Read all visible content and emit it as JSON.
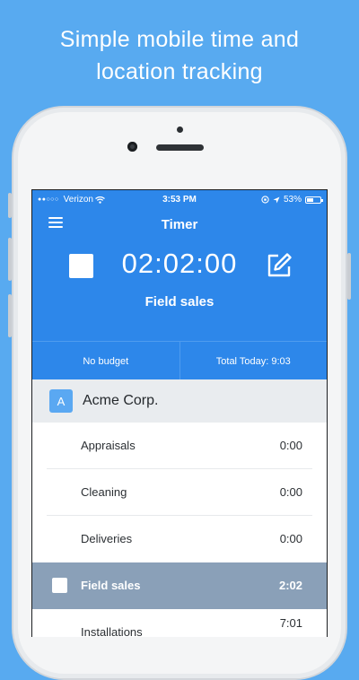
{
  "headline": {
    "line1": "Simple mobile time and",
    "line2": "location tracking"
  },
  "status_bar": {
    "signal": "●●○○○",
    "carrier": "Verizon",
    "time": "3:53 PM",
    "battery": "53%",
    "battery_fraction": 0.53
  },
  "header": {
    "title": "Timer",
    "menu_icon": "hamburger-menu-icon"
  },
  "timer": {
    "elapsed": "02:02:00",
    "activity": "Field sales",
    "stop_icon": "stop-icon",
    "edit_icon": "edit-icon"
  },
  "stats": {
    "budget": "No budget",
    "total_today": "Total Today: 9:03"
  },
  "client": {
    "initial": "A",
    "name": "Acme Corp."
  },
  "tasks": [
    {
      "label": "Appraisals",
      "time": "0:00"
    },
    {
      "label": "Cleaning",
      "time": "0:00"
    },
    {
      "label": "Deliveries",
      "time": "0:00"
    },
    {
      "label": "Field sales",
      "time": "2:02"
    },
    {
      "label": "Installations",
      "time": "7:01"
    }
  ],
  "colors": {
    "background": "#58aaf0",
    "app_blue": "#2d87ea",
    "active_row": "#8aa0b8",
    "client_bg": "#e9ecef"
  }
}
